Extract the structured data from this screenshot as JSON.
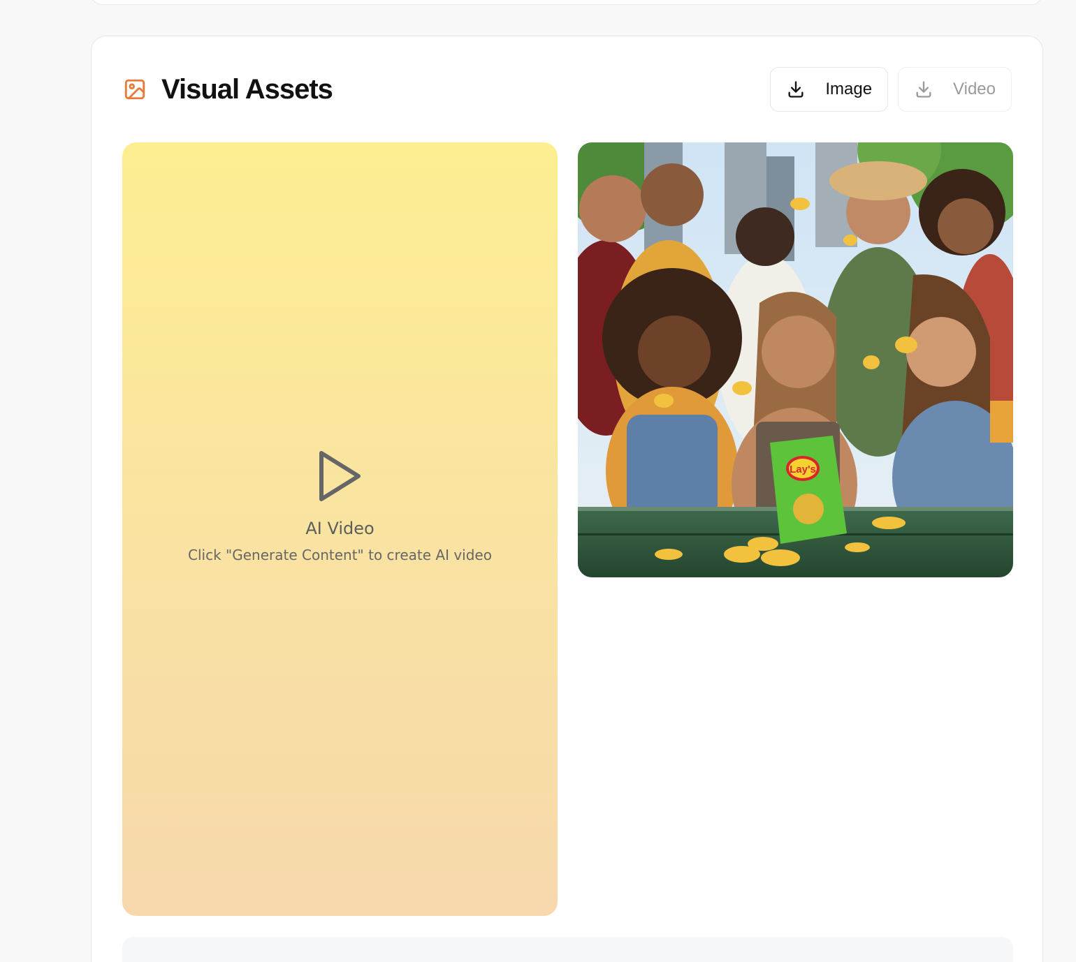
{
  "section": {
    "title": "Visual Assets",
    "icon": "image-icon",
    "accent_color": "#e8793a"
  },
  "actions": {
    "image_label": "Image",
    "video_label": "Video",
    "video_disabled": true
  },
  "video_placeholder": {
    "icon": "play-icon",
    "title": "AI Video",
    "subtitle": "Click \"Generate Content\" to create AI video",
    "gradient": [
      "#fdee92",
      "#f7d8ac"
    ]
  },
  "image_asset": {
    "depicts": "group of young people laughing and eating chips outdoors with a green chips bag",
    "bag_brand_text": "Lay's"
  }
}
